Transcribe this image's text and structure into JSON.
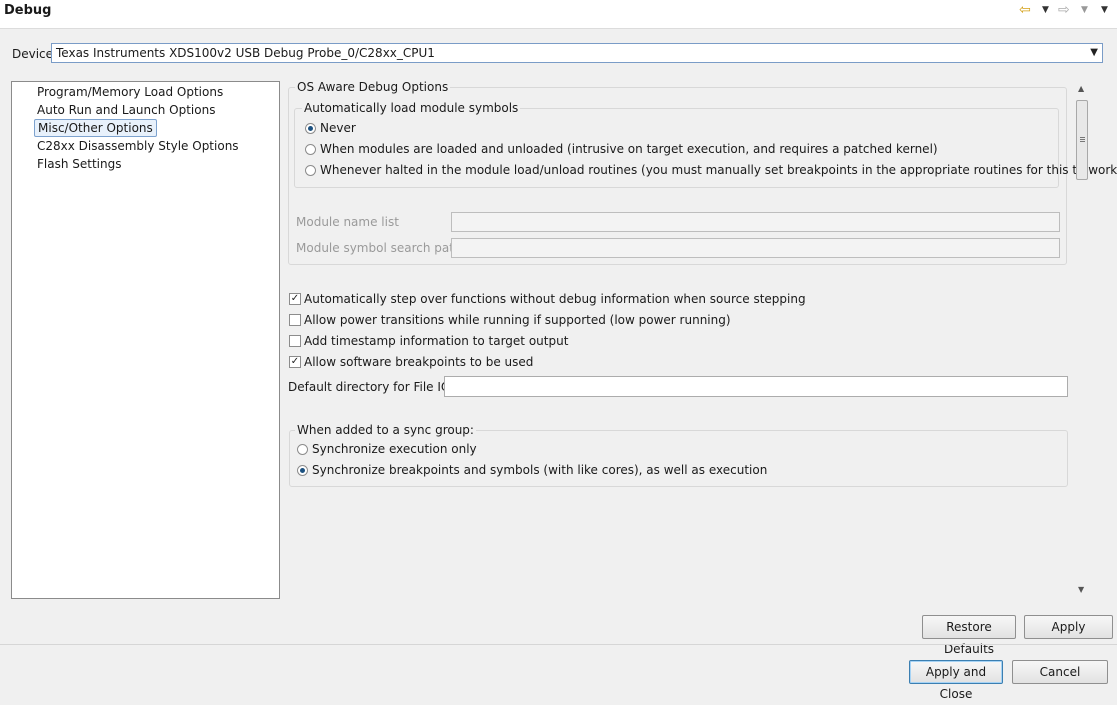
{
  "header": {
    "title": "Debug",
    "back_icon": "back-arrow-icon",
    "forward_icon": "forward-arrow-icon",
    "menu_icon": "view-menu-chevron-icon"
  },
  "device": {
    "label": "Device",
    "value": "Texas Instruments XDS100v2 USB Debug Probe_0/C28xx_CPU1"
  },
  "tree": {
    "items": [
      "Program/Memory Load Options",
      "Auto Run and Launch Options",
      "Misc/Other Options",
      "C28xx Disassembly Style Options",
      "Flash Settings"
    ],
    "selected": "Misc/Other Options"
  },
  "os_aware": {
    "title": "OS Aware Debug Options",
    "load_symbols": {
      "title": "Automatically load module symbols",
      "options": [
        "Never",
        "When modules are loaded and unloaded (intrusive on target execution, and requires a patched kernel)",
        "Whenever halted in the module load/unload routines (you must manually set breakpoints in the appropriate routines for this to work)"
      ],
      "selected": "Never"
    },
    "module_name_list_label": "Module name list",
    "module_name_list_value": "",
    "module_symbol_path_label": "Module symbol search path",
    "module_symbol_path_value": ""
  },
  "checks": [
    {
      "label": "Automatically step over functions without debug information when source stepping",
      "checked": true
    },
    {
      "label": "Allow power transitions while running if supported (low power running)",
      "checked": false
    },
    {
      "label": "Add timestamp information to target output",
      "checked": false
    },
    {
      "label": "Allow software breakpoints to be used",
      "checked": true
    }
  ],
  "file_io": {
    "label": "Default directory for File IO:",
    "value": ""
  },
  "sync_group": {
    "title": "When added to a sync group:",
    "options": [
      "Synchronize execution only",
      "Synchronize breakpoints and symbols (with like cores), as well as execution"
    ],
    "selected": "Synchronize breakpoints and symbols (with like cores), as well as execution"
  },
  "buttons": {
    "restore_defaults": "Restore Defaults",
    "apply": "Apply",
    "apply_and_close": "Apply and Close",
    "cancel": "Cancel"
  },
  "colors": {
    "selection_bg": "#e8f1fb",
    "selection_border": "#7da2ce",
    "radio_dot": "#1c5180",
    "default_button_border": "#3c7fb1"
  }
}
